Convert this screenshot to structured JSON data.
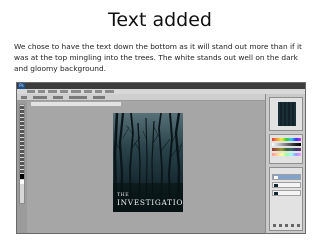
{
  "slide": {
    "title": "Text added",
    "body": "We chose to have the text down the bottom as it will stand out more than if it was at the top mingling into the trees. The white stands out well on the dark and gloomy background."
  },
  "screenshot": {
    "app_logo": "Ps",
    "document": {
      "line1": "THE",
      "line2": "INVESTIGATION"
    }
  },
  "colors": {
    "ui_background": "#9b9b9b",
    "poster_background": "#0e1d24",
    "poster_text": "#f2f2f2",
    "selected_layer": "#7fa3cc"
  }
}
